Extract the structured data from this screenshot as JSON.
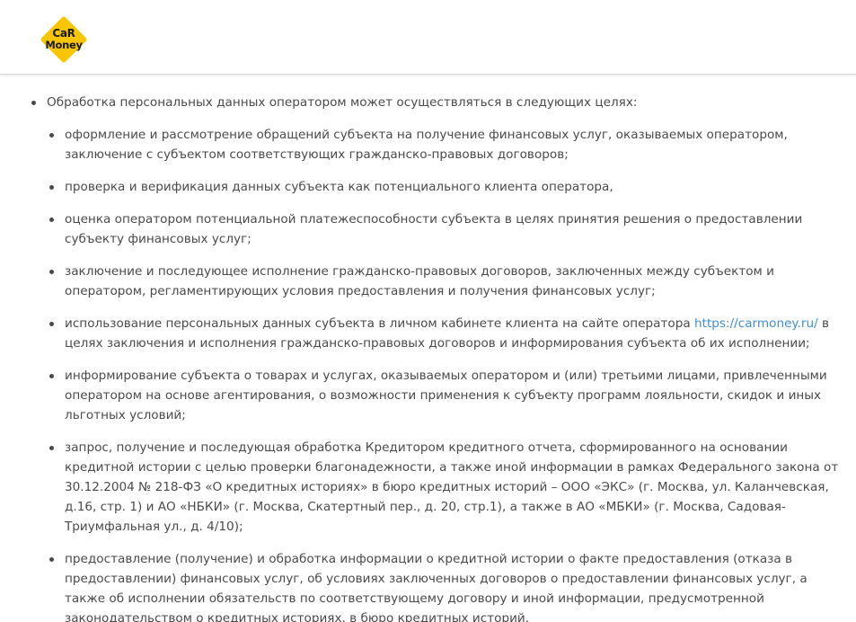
{
  "logo": {
    "line1": "CaR",
    "line2": "Money",
    "colors": {
      "diamond": "#f7c600",
      "diamond_border": "#ffffff",
      "text": "#1a1a1a"
    }
  },
  "colors": {
    "text": "#4a4a4a",
    "link": "#3d8fd6",
    "header_border": "#d6d6d6"
  },
  "section": {
    "intro": "Обработка персональных данных оператором может осуществляться в следующих целях:",
    "items": [
      {
        "text": "оформление и рассмотрение обращений субъекта на получение финансовых услуг, оказываемых оператором, заключение с субъектом соответствующих гражданско-правовых договоров;"
      },
      {
        "text": "проверка и верификация данных субъекта как потенциального клиента оператора,"
      },
      {
        "text": "оценка оператором потенциальной платежеспособности субъекта в целях принятия решения о предоставлении субъекту финансовых услуг;"
      },
      {
        "text": "заключение и последующее исполнение гражданско-правовых договоров, заключенных между субъектом и оператором, регламентирующих условия предоставления и получения финансовых услуг;"
      },
      {
        "text_before": "использование персональных данных субъекта в личном кабинете клиента на сайте оператора",
        "link": "https://carmoney.ru/",
        "text_after": "в целях заключения и исполнения гражданско-правовых договоров и информирования субъекта об их исполнении;"
      },
      {
        "text": "информирование субъекта о товарах и услугах, оказываемых оператором и (или) третьими лицами, привлеченными оператором на основе агентирования, о возможности применения к субъекту программ лояльности, скидок и иных льготных условий;"
      },
      {
        "text": "запрос, получение и последующая обработка Кредитором кредитного отчета, сформированного на основании кредитной истории с целью проверки благонадежности, а также иной информации в рамках Федерального закона от 30.12.2004 № 218-ФЗ «О кредитных историях» в бюро кредитных историй – ООО «ЭКС» (г. Москва, ул. Каланчевская, д.16, стр. 1) и АО «НБКИ» (г. Москва, Скатертный пер., д. 20, стр.1), а также в АО «МБКИ» (г. Москва, Садовая-Триумфальная ул., д. 4/10);"
      },
      {
        "text": "предоставление (получение) и обработка информации о кредитной истории о факте предоставления (отказа в предоставлении) финансовых услуг, об условиях заключенных договоров о предоставлении финансовых услуг, а также об исполнении обязательств по соответствующему договору и иной информации, предусмотренной законодательством о кредитных историях, в бюро кредитных историй."
      }
    ]
  }
}
